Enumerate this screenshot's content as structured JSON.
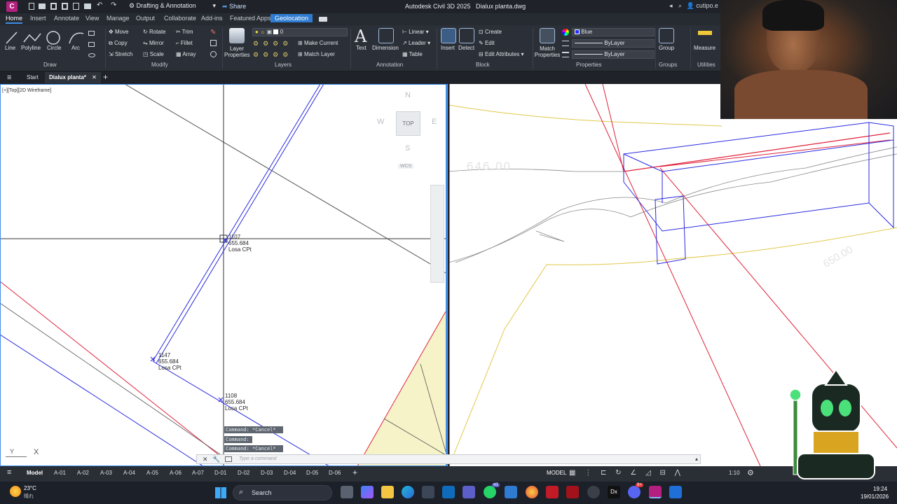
{
  "title_bar": {
    "app_icon": "C",
    "workspace": "Drafting & Annotation",
    "share_label": "Share",
    "title": "Autodesk Civil 3D 2025   Dialux planta.dwg",
    "user": "cutipo.e"
  },
  "ribbon_tabs": [
    "Home",
    "Insert",
    "Annotate",
    "View",
    "Manage",
    "Output",
    "Collaborate",
    "Add-ins",
    "Featured Apps",
    "Geolocation"
  ],
  "ribbon": {
    "draw": {
      "line": "Line",
      "polyline": "Polyline",
      "circle": "Circle",
      "arc": "Arc",
      "panel": "Draw"
    },
    "modify": {
      "move": "Move",
      "rotate": "Rotate",
      "trim": "Trim",
      "copy": "Copy",
      "mirror": "Mirror",
      "fillet": "Fillet",
      "stretch": "Stretch",
      "scale": "Scale",
      "array": "Array",
      "panel": "Modify"
    },
    "layers": {
      "layer_properties": "Layer Properties",
      "current_layer": "0",
      "make_current": "Make Current",
      "match_layer": "Match Layer",
      "panel": "Layers"
    },
    "annotation": {
      "text": "Text",
      "dimension": "Dimension",
      "linear": "Linear",
      "leader": "Leader",
      "table": "Table",
      "panel": "Annotation"
    },
    "block": {
      "insert": "Insert",
      "detect": "Detect",
      "create": "Create",
      "edit": "Edit",
      "edit_attributes": "Edit Attributes",
      "panel": "Block"
    },
    "properties": {
      "match_properties": "Match Properties",
      "color": "Blue",
      "linetype": "ByLayer",
      "lineweight": "ByLayer",
      "panel": "Properties"
    },
    "groups": {
      "group": "Group",
      "panel": "Groups"
    },
    "utilities": {
      "measure": "Measure",
      "panel": "Utilities"
    }
  },
  "doc_tabs": {
    "start": "Start",
    "active": "Dialux planta*"
  },
  "viewport": {
    "label": "[+][Top][2D Wireframe]",
    "viewcube": {
      "n": "N",
      "s": "S",
      "e": "E",
      "w": "W",
      "top": "TOP",
      "wcs": "WCS"
    },
    "points": [
      {
        "id": "1107",
        "elev": "655.684",
        "desc": "Losa CPt"
      },
      {
        "id": "1147",
        "elev": "655.684",
        "desc": "Losa CPt"
      },
      {
        "id": "1108",
        "elev": "655.684",
        "desc": "Losa CPt"
      }
    ],
    "contour_labels": [
      "646.00",
      "650.00"
    ],
    "commands": [
      "Command: *Cancel*",
      "Command:",
      "Command: *Cancel*"
    ],
    "command_placeholder": "Type a command",
    "ucs": {
      "y": "Y",
      "x": "X"
    }
  },
  "layout_tabs": [
    "Model",
    "A-01",
    "A-02",
    "A-03",
    "A-04",
    "A-05",
    "A-06",
    "A-07",
    "D-01",
    "D-02",
    "D-03",
    "D-04",
    "D-05",
    "D-06"
  ],
  "status": {
    "model": "MODEL",
    "scale": "1:10"
  },
  "taskbar": {
    "weather_temp": "23°C",
    "weather_desc": "晴れ",
    "search": "Search",
    "whatsapp_badge": "43",
    "discord_badge": "9+",
    "time": "19:24",
    "date": "19/01/2026"
  },
  "colors": {
    "accent": "#2f7bd1",
    "blue_line": "#2a2ae0",
    "red_line": "#e0223a",
    "yellow_fill": "#f7f3c8",
    "contour": "#888888",
    "yellow_contour": "#e2c84a"
  }
}
